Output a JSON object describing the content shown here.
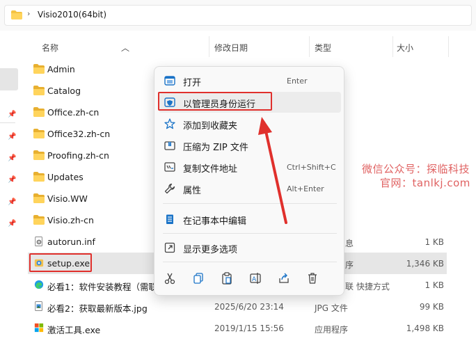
{
  "address": {
    "separator": "›",
    "path": "Visio2010(64bit)"
  },
  "columns": {
    "name": "名称",
    "date": "修改日期",
    "type": "类型",
    "size": "大小"
  },
  "files": [
    {
      "name": "Admin",
      "icon": "folder-icon",
      "date": "",
      "type": "",
      "size": ""
    },
    {
      "name": "Catalog",
      "icon": "folder-icon",
      "date": "",
      "type": "",
      "size": ""
    },
    {
      "name": "Office.zh-cn",
      "icon": "folder-icon",
      "date": "",
      "type": "",
      "size": ""
    },
    {
      "name": "Office32.zh-cn",
      "icon": "folder-icon",
      "date": "",
      "type": "",
      "size": ""
    },
    {
      "name": "Proofing.zh-cn",
      "icon": "folder-icon",
      "date": "",
      "type": "",
      "size": ""
    },
    {
      "name": "Updates",
      "icon": "folder-icon",
      "date": "",
      "type": "",
      "size": ""
    },
    {
      "name": "Visio.WW",
      "icon": "folder-icon",
      "date": "",
      "type": "",
      "size": ""
    },
    {
      "name": "Visio.zh-cn",
      "icon": "folder-icon",
      "date": "",
      "type": "",
      "size": ""
    },
    {
      "name": "autorun.inf",
      "icon": "settings-file-icon",
      "date": "",
      "type": "息",
      "size": "1 KB"
    },
    {
      "name": "setup.exe",
      "icon": "setup-exe-icon",
      "date": "",
      "type": "序",
      "size": "1,346 KB"
    },
    {
      "name": "必看1：软件安装教程（需联",
      "icon": "edge-shortcut-icon",
      "date": "",
      "type": "联 快捷方式",
      "size": "1 KB"
    },
    {
      "name": "必看2：获取最新版本.jpg",
      "icon": "image-file-icon",
      "date": "2025/6/20 23:14",
      "type": "JPG 文件",
      "size": "99 KB"
    },
    {
      "name": "激活工具.exe",
      "icon": "windows-app-icon",
      "date": "2019/1/15 15:56",
      "type": "应用程序",
      "size": "1,498 KB"
    }
  ],
  "context_menu": {
    "items": [
      {
        "label": "打开",
        "shortcut": "Enter",
        "icon": "open-icon"
      },
      {
        "label": "以管理员身份运行",
        "shortcut": "",
        "icon": "shield-icon"
      },
      {
        "label": "添加到收藏夹",
        "shortcut": "",
        "icon": "star-icon"
      },
      {
        "label": "压缩为 ZIP 文件",
        "shortcut": "",
        "icon": "zip-icon"
      },
      {
        "label": "复制文件地址",
        "shortcut": "Ctrl+Shift+C",
        "icon": "copy-path-icon"
      },
      {
        "label": "属性",
        "shortcut": "Alt+Enter",
        "icon": "wrench-icon"
      },
      {
        "label": "在记事本中编辑",
        "shortcut": "",
        "icon": "notepad-icon"
      },
      {
        "label": "显示更多选项",
        "shortcut": "",
        "icon": "more-options-icon"
      }
    ],
    "quick_actions": [
      "cut-icon",
      "copy-icon",
      "paste-icon",
      "rename-icon",
      "share-icon",
      "delete-icon"
    ]
  },
  "watermark": {
    "line1": "微信公众号：探临科技",
    "line2": "官网：tanlkj.com"
  },
  "colors": {
    "highlight_red": "#e0302c",
    "folder_yellow": "#f5c342",
    "selection_gray": "#e6e6e6",
    "accent_blue": "#1a73c7"
  }
}
